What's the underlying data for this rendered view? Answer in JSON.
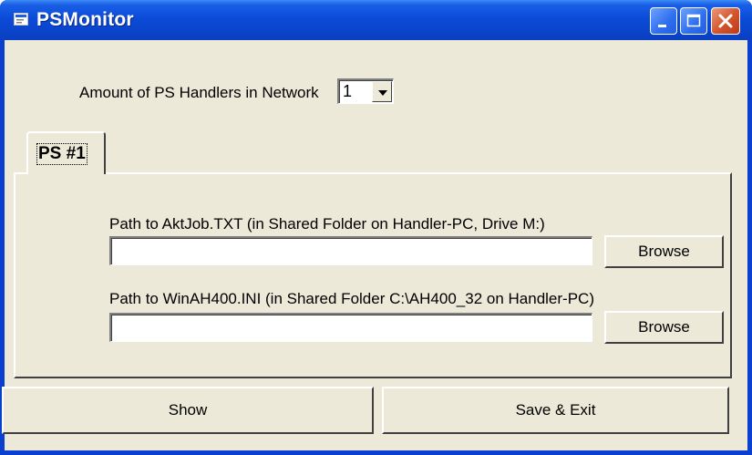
{
  "window": {
    "title": "PSMonitor",
    "icon": "app-icon",
    "controls": {
      "minimize": "minimize-icon",
      "maximize": "maximize-icon",
      "close": "close-icon"
    }
  },
  "header": {
    "amount_label": "Amount of PS Handlers in Network",
    "amount_value": "1"
  },
  "tabs": [
    {
      "label": "PS #1"
    }
  ],
  "panel": {
    "aktjob_label": "Path to AktJob.TXT (in Shared Folder on Handler-PC, Drive M:)",
    "aktjob_value": "",
    "winah_label": "Path to WinAH400.INI (in Shared Folder C:\\AH400_32 on Handler-PC)",
    "winah_value": "",
    "browse_label": "Browse"
  },
  "footer": {
    "show_label": "Show",
    "save_exit_label": "Save & Exit"
  },
  "colors": {
    "titlebar": "#0b4bd8",
    "client": "#ece9d8",
    "close_button": "#d2532c"
  }
}
